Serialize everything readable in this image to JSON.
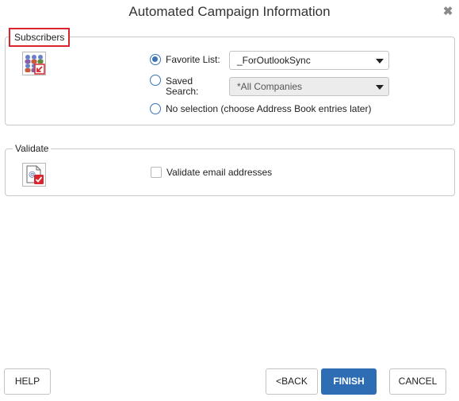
{
  "dialog": {
    "title": "Automated Campaign Information",
    "close_glyph": "✖"
  },
  "subscribers": {
    "legend": "Subscribers",
    "icon": "subscribers-list-icon",
    "favorite_list": {
      "label": "Favorite List:",
      "checked": true,
      "value": "_ForOutlookSync"
    },
    "saved_search": {
      "label_line1": "Saved",
      "label_line2": "Search:",
      "checked": false,
      "value": "*All Companies",
      "disabled": true
    },
    "no_selection": {
      "label": "No selection (choose Address Book entries later)",
      "checked": false
    }
  },
  "validate": {
    "legend": "Validate",
    "icon": "validate-email-icon",
    "checkbox_label": "Validate email addresses",
    "checked": false
  },
  "footer": {
    "help": "HELP",
    "back": "<BACK",
    "finish": "FINISH",
    "cancel": "CANCEL"
  },
  "colors": {
    "accent": "#2e6db4",
    "highlight": "#d9252e"
  }
}
